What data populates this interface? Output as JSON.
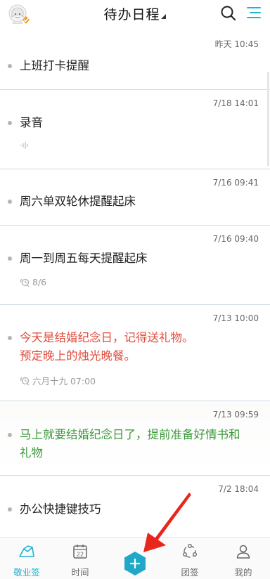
{
  "header": {
    "title": "待办日程",
    "accent": "#1fb3d1"
  },
  "items": [
    {
      "time": "昨天 10:45",
      "text": "上班打卡提醒",
      "color": "#222222",
      "sub": ""
    },
    {
      "time": "7/18 14:01",
      "text": "录音",
      "color": "#222222",
      "sub": ""
    },
    {
      "time": "7/16 09:41",
      "text": "周六单双轮休提醒起床",
      "color": "#222222",
      "sub": ""
    },
    {
      "time": "7/16 09:40",
      "text": "周一到周五每天提醒起床",
      "color": "#222222",
      "sub": "8/6"
    },
    {
      "time": "7/13 10:00",
      "text_line1": "今天是结婚纪念日，记得送礼物。",
      "text_line2": "预定晚上的烛光晚餐。",
      "color": "#e04a3c",
      "sub": "六月十九 07:00"
    },
    {
      "time": "7/13 09:59",
      "text_line1": "马上就要结婚纪念日了，提前准备好情书和",
      "text_line2": "礼物",
      "color": "#3c9a3c",
      "sub": ""
    },
    {
      "time": "7/2 18:04",
      "text": "办公快捷键技巧",
      "color": "#222222",
      "sub": ""
    }
  ],
  "nav": {
    "items": [
      {
        "label": "敬业签",
        "icon": "note-icon",
        "active": true
      },
      {
        "label": "时间",
        "icon": "calendar-icon",
        "active": false
      },
      {
        "label": "团签",
        "icon": "team-icon",
        "active": false
      },
      {
        "label": "我的",
        "icon": "profile-icon",
        "active": false
      }
    ],
    "calendar_day": "22"
  },
  "colors": {
    "divider": "#cfdbe4",
    "accent": "#1fb3d1",
    "fab": "#1fa8c8",
    "arrow": "#e8271c"
  }
}
